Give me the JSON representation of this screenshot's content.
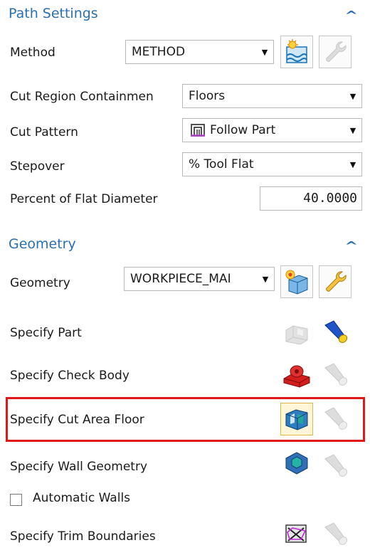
{
  "path_settings": {
    "title": "Path Settings",
    "collapse_icon": "chevron-up-icon",
    "method": {
      "label": "Method",
      "value": "METHOD"
    },
    "cut_region": {
      "label": "Cut Region Containmen",
      "value": "Floors"
    },
    "cut_pattern": {
      "label": "Cut Pattern",
      "value": "Follow Part"
    },
    "stepover": {
      "label": "Stepover",
      "value": "% Tool Flat"
    },
    "percent_flat": {
      "label": "Percent of Flat Diameter",
      "value": "40.0000"
    }
  },
  "geometry": {
    "title": "Geometry",
    "collapse_icon": "chevron-up-icon",
    "geometry": {
      "label": "Geometry",
      "value": "WORKPIECE_MAI"
    },
    "specify_part": {
      "label": "Specify Part"
    },
    "specify_check_body": {
      "label": "Specify Check Body"
    },
    "specify_cut_area_floor": {
      "label": "Specify Cut Area Floor",
      "highlighted": true
    },
    "specify_wall_geometry": {
      "label": "Specify Wall Geometry"
    },
    "automatic_walls": {
      "label": "Automatic Walls",
      "checked": false
    },
    "specify_trim_boundaries": {
      "label": "Specify Trim Boundaries"
    }
  },
  "colors": {
    "section_title": "#2b6fb3",
    "highlight_border": "#e01818"
  }
}
